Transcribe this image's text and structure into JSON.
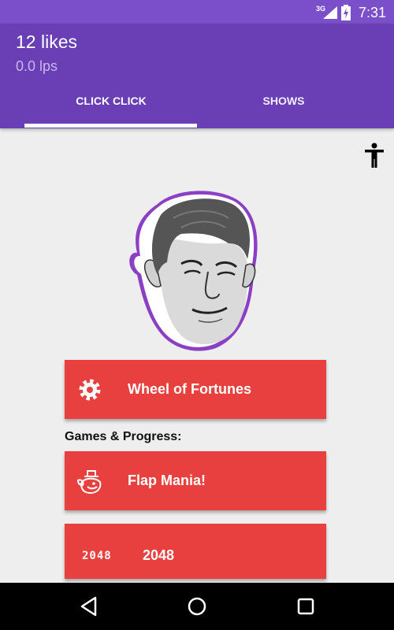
{
  "status_bar": {
    "network": "3G",
    "time": "7:31",
    "icons": [
      "signal-icon",
      "battery-charging-icon"
    ]
  },
  "header": {
    "likes": "12 likes",
    "rate": "0.0 lps"
  },
  "tabs": [
    {
      "label": "CLICK CLICK",
      "active": true
    },
    {
      "label": "SHOWS",
      "active": false
    }
  ],
  "main": {
    "accessibility_icon": "accessibility-icon",
    "face_image": "character-face",
    "wheel_button": {
      "label": "Wheel of Fortunes",
      "icon": "gear-icon"
    },
    "section_title": "Games & Progress:",
    "games": [
      {
        "label": "Flap Mania!",
        "icon": "bird-icon"
      },
      {
        "label": "2048",
        "icon_text": "2048"
      }
    ]
  },
  "colors": {
    "status_bar": "#7b4fc9",
    "app_bar": "#6a3fb5",
    "button": "#e8403e",
    "background": "#eeeeee"
  },
  "nav_bar": {
    "icons": [
      "back-icon",
      "home-icon",
      "recents-icon"
    ]
  }
}
